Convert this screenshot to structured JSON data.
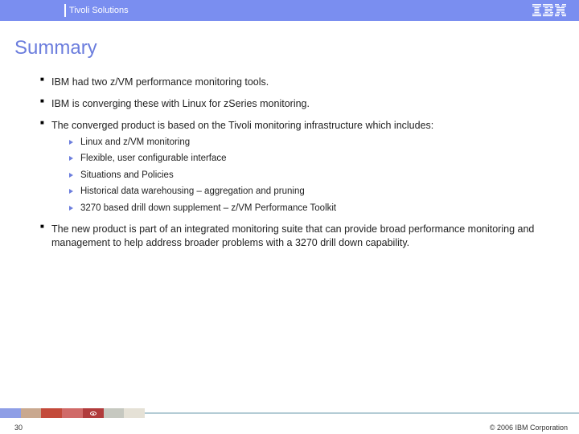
{
  "header": {
    "section": "Tivoli Solutions",
    "brand": "IBM"
  },
  "title": "Summary",
  "bullets": [
    {
      "text": "IBM had two z/VM performance monitoring tools."
    },
    {
      "text": "IBM is converging these with Linux for zSeries monitoring."
    },
    {
      "text": "The converged product is based on the Tivoli monitoring infrastructure which includes:",
      "sub": [
        "Linux and z/VM monitoring",
        "Flexible, user configurable interface",
        "Situations and Policies",
        "Historical data warehousing – aggregation and pruning",
        "3270 based drill down supplement – z/VM Performance Toolkit"
      ]
    },
    {
      "text": "The new product is part of an integrated monitoring suite that can provide broad performance monitoring and management to help address broader problems with a 3270 drill down capability."
    }
  ],
  "footer": {
    "page": "30",
    "copyright": "© 2006 IBM Corporation"
  }
}
